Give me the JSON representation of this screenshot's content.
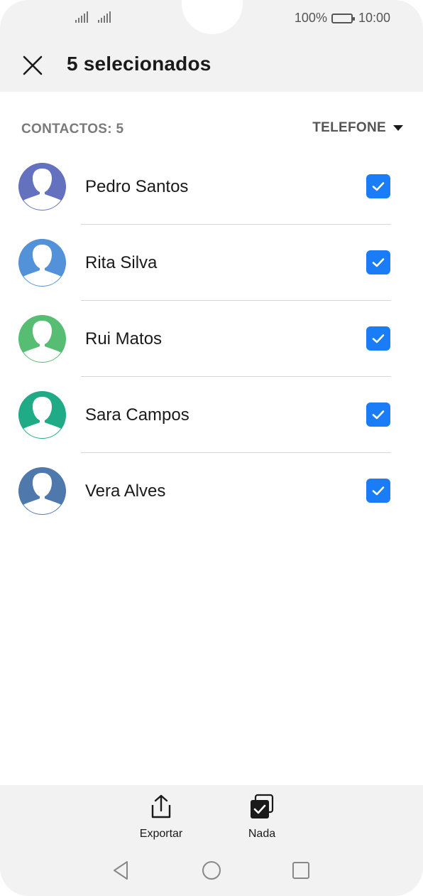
{
  "status_bar": {
    "battery": "100%",
    "time": "10:00"
  },
  "header": {
    "title": "5 selecionados"
  },
  "list": {
    "count_label": "CONTACTOS: 5",
    "sort_label": "TELEFONE"
  },
  "contacts": [
    {
      "name": "Pedro Santos",
      "color": "#6471be",
      "checked": true
    },
    {
      "name": "Rita Silva",
      "color": "#5391d9",
      "checked": true
    },
    {
      "name": "Rui Matos",
      "color": "#57bd72",
      "checked": true
    },
    {
      "name": "Sara Campos",
      "color": "#1eab86",
      "checked": true
    },
    {
      "name": "Vera Alves",
      "color": "#4f79ad",
      "checked": true
    }
  ],
  "actions": {
    "export_label": "Exportar",
    "none_label": "Nada"
  },
  "colors": {
    "accent": "#1a7cf6",
    "bar_bg": "#f2f2f2"
  },
  "icons": {
    "close": "close-icon",
    "export": "share-icon",
    "none": "deselect-all-icon",
    "back": "back-icon",
    "home": "home-icon",
    "recents": "recents-icon"
  }
}
